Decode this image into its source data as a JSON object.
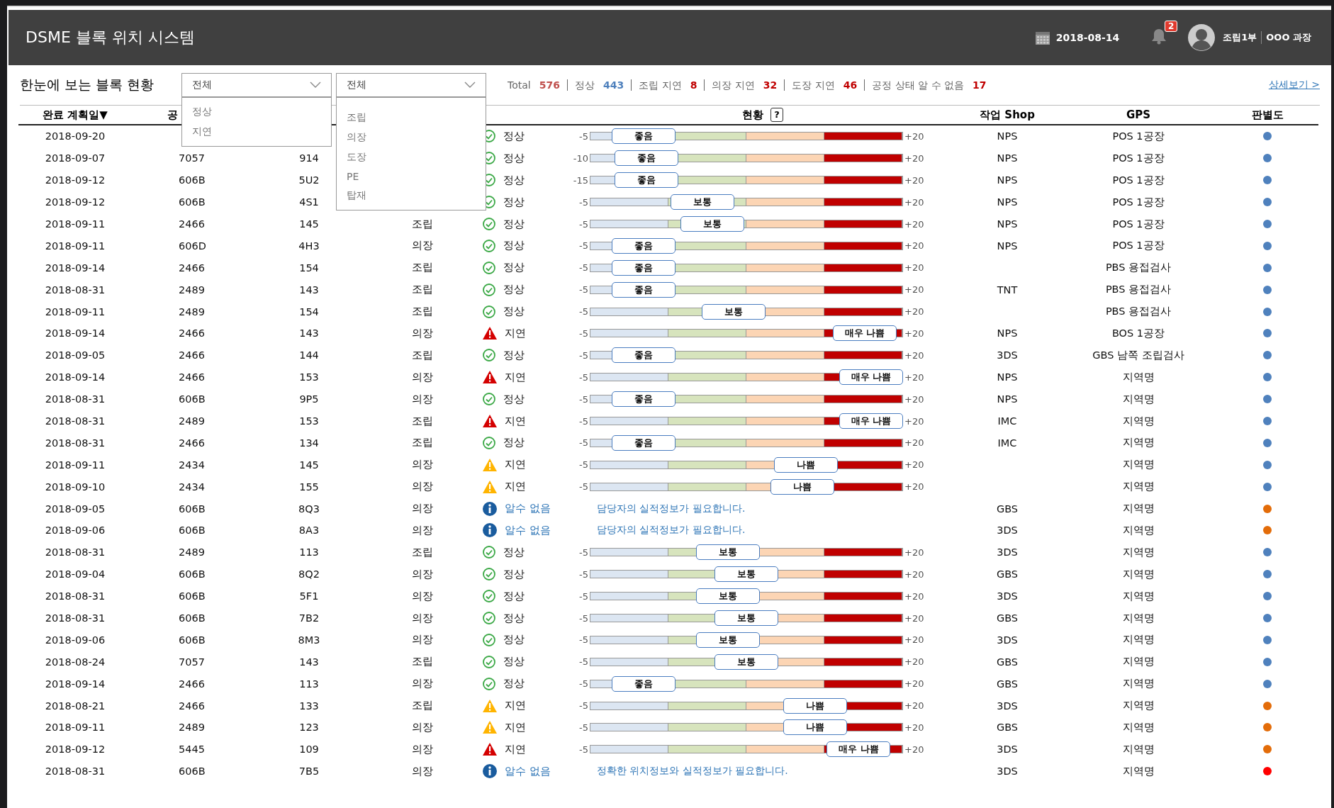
{
  "header": {
    "title": "DSME 블록 위치 시스템",
    "date": "2018-08-14",
    "notifications": "2",
    "department": "조립1부",
    "user": "OOO 과장"
  },
  "section_title": "한눈에 보는 블록 현황",
  "filters": [
    {
      "value": "전체",
      "expanded": true,
      "options": [
        "정상",
        "지연"
      ]
    },
    {
      "value": "전체",
      "expanded": true,
      "options": [
        "조립",
        "의장",
        "도장",
        "PE",
        "탑재"
      ]
    }
  ],
  "stats": [
    {
      "label": "Total",
      "value": "576",
      "color": "#c0504d"
    },
    {
      "label": "정상",
      "value": "443",
      "color": "#4f81bd"
    },
    {
      "label": "조립 지연",
      "value": "8",
      "color": "#c00000"
    },
    {
      "label": "의장 지연",
      "value": "32",
      "color": "#c00000"
    },
    {
      "label": "도장 지연",
      "value": "46",
      "color": "#c00000"
    },
    {
      "label": "공정 상태 알 수 없음",
      "value": "17",
      "color": "#c00000"
    }
  ],
  "detail_link": "상세보기 >",
  "columns": {
    "date": "완료 계획일▼",
    "column_2": "공",
    "status": "현황",
    "help": "?",
    "shop": "작업 Shop",
    "gps": "GPS",
    "rating": "판별도"
  },
  "rows": [
    {
      "date": "2018-09-20",
      "status": {
        "kind": "ok",
        "label": "정상"
      },
      "scale_min": "-5",
      "grade": "좋음",
      "level": 0.17,
      "scale_max": "+20",
      "shop": "NPS",
      "gps": "POS 1공장",
      "color": "#4f81bd"
    },
    {
      "date": "2018-09-07",
      "column_2": "7057",
      "column_3": "914",
      "status": {
        "kind": "ok",
        "label": "정상"
      },
      "scale_min": "-10",
      "grade": "좋음",
      "level": 0.18,
      "scale_max": "+20",
      "shop": "NPS",
      "gps": "POS 1공장",
      "color": "#4f81bd"
    },
    {
      "date": "2018-09-12",
      "column_2": "606B",
      "column_3": "5U2",
      "status": {
        "kind": "ok",
        "label": "정상"
      },
      "scale_min": "-15",
      "grade": "좋음",
      "level": 0.18,
      "scale_max": "+20",
      "shop": "NPS",
      "gps": "POS 1공장",
      "color": "#4f81bd"
    },
    {
      "date": "2018-09-12",
      "column_2": "606B",
      "column_3": "4S1",
      "status": {
        "kind": "ok",
        "label": "정상"
      },
      "scale_min": "-5",
      "grade": "보통",
      "level": 0.36,
      "scale_max": "+20",
      "shop": "NPS",
      "gps": "POS 1공장",
      "color": "#4f81bd"
    },
    {
      "date": "2018-09-11",
      "column_2": "2466",
      "column_3": "145",
      "column_4": "조립",
      "status": {
        "kind": "ok",
        "label": "정상"
      },
      "scale_min": "-5",
      "grade": "보통",
      "level": 0.39,
      "scale_max": "+20",
      "shop": "NPS",
      "gps": "POS 1공장",
      "color": "#4f81bd"
    },
    {
      "date": "2018-09-11",
      "column_2": "606D",
      "column_3": "4H3",
      "column_4": "의장",
      "status": {
        "kind": "ok",
        "label": "정상"
      },
      "scale_min": "-5",
      "grade": "좋음",
      "level": 0.17,
      "scale_max": "+20",
      "shop": "NPS",
      "gps": "POS 1공장",
      "color": "#4f81bd"
    },
    {
      "date": "2018-09-14",
      "column_2": "2466",
      "column_3": "154",
      "column_4": "조립",
      "status": {
        "kind": "ok",
        "label": "정상"
      },
      "scale_min": "-5",
      "grade": "좋음",
      "level": 0.17,
      "scale_max": "+20",
      "gps": "PBS 용접검사",
      "color": "#4f81bd"
    },
    {
      "date": "2018-08-31",
      "column_2": "2489",
      "column_3": "143",
      "column_4": "조립",
      "status": {
        "kind": "ok",
        "label": "정상"
      },
      "scale_min": "-5",
      "grade": "좋음",
      "level": 0.17,
      "scale_max": "+20",
      "shop": "TNT",
      "gps": "PBS 용접검사",
      "color": "#4f81bd"
    },
    {
      "date": "2018-09-11",
      "column_2": "2489",
      "column_3": "154",
      "column_4": "조립",
      "status": {
        "kind": "ok",
        "label": "정상"
      },
      "scale_min": "-5",
      "grade": "보통",
      "level": 0.46,
      "scale_max": "+20",
      "gps": "PBS 용접검사",
      "color": "#4f81bd"
    },
    {
      "date": "2018-09-14",
      "column_2": "2466",
      "column_3": "143",
      "column_4": "의장",
      "status": {
        "kind": "danger",
        "label": "지연"
      },
      "scale_min": "-5",
      "grade": "매우 나쁨",
      "level": 0.88,
      "scale_max": "+20",
      "shop": "NPS",
      "gps": "BOS 1공장",
      "color": "#4f81bd"
    },
    {
      "date": "2018-09-05",
      "column_2": "2466",
      "column_3": "144",
      "column_4": "조립",
      "status": {
        "kind": "ok",
        "label": "정상"
      },
      "scale_min": "-5",
      "grade": "좋음",
      "level": 0.17,
      "scale_max": "+20",
      "shop": "3DS",
      "gps": "GBS 남쪽 조립검사",
      "color": "#4f81bd"
    },
    {
      "date": "2018-09-14",
      "column_2": "2466",
      "column_3": "153",
      "column_4": "의장",
      "status": {
        "kind": "danger",
        "label": "지연"
      },
      "scale_min": "-5",
      "grade": "매우 나쁨",
      "level": 0.9,
      "scale_max": "+20",
      "shop": "NPS",
      "gps": "지역명",
      "color": "#4f81bd"
    },
    {
      "date": "2018-08-31",
      "column_2": "606B",
      "column_3": "9P5",
      "column_4": "의장",
      "status": {
        "kind": "ok",
        "label": "정상"
      },
      "scale_min": "-5",
      "grade": "좋음",
      "level": 0.17,
      "scale_max": "+20",
      "shop": "NPS",
      "gps": "지역명",
      "color": "#4f81bd"
    },
    {
      "date": "2018-08-31",
      "column_2": "2489",
      "column_3": "153",
      "column_4": "조립",
      "status": {
        "kind": "danger",
        "label": "지연"
      },
      "scale_min": "-5",
      "grade": "매우 나쁨",
      "level": 0.9,
      "scale_max": "+20",
      "shop": "IMC",
      "gps": "지역명",
      "color": "#4f81bd"
    },
    {
      "date": "2018-08-31",
      "column_2": "2466",
      "column_3": "134",
      "column_4": "조립",
      "status": {
        "kind": "ok",
        "label": "정상"
      },
      "scale_min": "-5",
      "grade": "좋음",
      "level": 0.17,
      "scale_max": "+20",
      "shop": "IMC",
      "gps": "지역명",
      "color": "#4f81bd"
    },
    {
      "date": "2018-09-11",
      "column_2": "2434",
      "column_3": "145",
      "column_4": "의장",
      "status": {
        "kind": "warning",
        "label": "지연"
      },
      "scale_min": "-5",
      "grade": "나쁨",
      "level": 0.69,
      "scale_max": "+20",
      "gps": "지역명",
      "color": "#4f81bd"
    },
    {
      "date": "2018-09-10",
      "column_2": "2434",
      "column_3": "155",
      "column_4": "의장",
      "status": {
        "kind": "warning",
        "label": "지연"
      },
      "scale_min": "-5",
      "grade": "나쁨",
      "level": 0.68,
      "scale_max": "+20",
      "gps": "지역명",
      "color": "#4f81bd"
    },
    {
      "date": "2018-09-05",
      "column_2": "606B",
      "column_3": "8Q3",
      "column_4": "의장",
      "status": {
        "kind": "info",
        "label": "알수 없음"
      },
      "message": "담당자의 실적정보가 필요합니다.",
      "shop": "GBS",
      "gps": "지역명",
      "color": "#e36c09"
    },
    {
      "date": "2018-09-06",
      "column_2": "606B",
      "column_3": "8A3",
      "column_4": "의장",
      "status": {
        "kind": "info",
        "label": "알수 없음"
      },
      "message": "담당자의 실적정보가 필요합니다.",
      "shop": "3DS",
      "gps": "지역명",
      "color": "#e36c09"
    },
    {
      "date": "2018-08-31",
      "column_2": "2489",
      "column_3": "113",
      "column_4": "조립",
      "status": {
        "kind": "ok",
        "label": "정상"
      },
      "scale_min": "-5",
      "grade": "보통",
      "level": 0.44,
      "scale_max": "+20",
      "shop": "3DS",
      "gps": "지역명",
      "color": "#4f81bd"
    },
    {
      "date": "2018-09-04",
      "column_2": "606B",
      "column_3": "8Q2",
      "column_4": "의장",
      "status": {
        "kind": "ok",
        "label": "정상"
      },
      "scale_min": "-5",
      "grade": "보통",
      "level": 0.5,
      "scale_max": "+20",
      "shop": "GBS",
      "gps": "지역명",
      "color": "#4f81bd"
    },
    {
      "date": "2018-08-31",
      "column_2": "606B",
      "column_3": "5F1",
      "column_4": "의장",
      "status": {
        "kind": "ok",
        "label": "정상"
      },
      "scale_min": "-5",
      "grade": "보통",
      "level": 0.44,
      "scale_max": "+20",
      "shop": "3DS",
      "gps": "지역명",
      "color": "#4f81bd"
    },
    {
      "date": "2018-08-31",
      "column_2": "606B",
      "column_3": "7B2",
      "column_4": "의장",
      "status": {
        "kind": "ok",
        "label": "정상"
      },
      "scale_min": "-5",
      "grade": "보통",
      "level": 0.5,
      "scale_max": "+20",
      "shop": "GBS",
      "gps": "지역명",
      "color": "#4f81bd"
    },
    {
      "date": "2018-09-06",
      "column_2": "606B",
      "column_3": "8M3",
      "column_4": "의장",
      "status": {
        "kind": "ok",
        "label": "정상"
      },
      "scale_min": "-5",
      "grade": "보통",
      "level": 0.44,
      "scale_max": "+20",
      "shop": "3DS",
      "gps": "지역명",
      "color": "#4f81bd"
    },
    {
      "date": "2018-08-24",
      "column_2": "7057",
      "column_3": "143",
      "column_4": "조립",
      "status": {
        "kind": "ok",
        "label": "정상"
      },
      "scale_min": "-5",
      "grade": "보통",
      "level": 0.5,
      "scale_max": "+20",
      "shop": "GBS",
      "gps": "지역명",
      "color": "#4f81bd"
    },
    {
      "date": "2018-09-14",
      "column_2": "2466",
      "column_3": "113",
      "column_4": "의장",
      "status": {
        "kind": "ok",
        "label": "정상"
      },
      "scale_min": "-5",
      "grade": "좋음",
      "level": 0.17,
      "scale_max": "+20",
      "shop": "GBS",
      "gps": "지역명",
      "color": "#4f81bd"
    },
    {
      "date": "2018-08-21",
      "column_2": "2466",
      "column_3": "133",
      "column_4": "조립",
      "status": {
        "kind": "warning",
        "label": "지연"
      },
      "scale_min": "-5",
      "grade": "나쁨",
      "level": 0.72,
      "scale_max": "+20",
      "shop": "3DS",
      "gps": "지역명",
      "color": "#e36c09"
    },
    {
      "date": "2018-09-11",
      "column_2": "2489",
      "column_3": "123",
      "column_4": "의장",
      "status": {
        "kind": "warning",
        "label": "지연"
      },
      "scale_min": "-5",
      "grade": "나쁨",
      "level": 0.72,
      "scale_max": "+20",
      "shop": "GBS",
      "gps": "지역명",
      "color": "#e36c09"
    },
    {
      "date": "2018-09-12",
      "column_2": "5445",
      "column_3": "109",
      "column_4": "의장",
      "status": {
        "kind": "danger",
        "label": "지연"
      },
      "scale_min": "-5",
      "grade": "매우 나쁨",
      "level": 0.86,
      "scale_max": "+20",
      "shop": "3DS",
      "gps": "지역명",
      "color": "#e36c09"
    },
    {
      "date": "2018-08-31",
      "column_2": "606B",
      "column_3": "7B5",
      "column_4": "의장",
      "status": {
        "kind": "info",
        "label": "알수 없음"
      },
      "message": "정확한 위치정보와 실적정보가 필요합니다.",
      "shop": "3DS",
      "gps": "지역명",
      "color": "#ff0000"
    }
  ]
}
